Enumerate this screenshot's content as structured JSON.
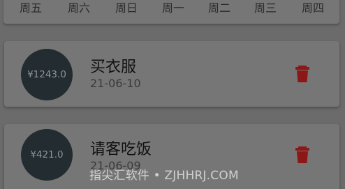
{
  "weekdays": [
    "周五",
    "周六",
    "周日",
    "周一",
    "周二",
    "周三",
    "周四"
  ],
  "records": [
    {
      "amount": "¥1243.0",
      "title": "买衣服",
      "date": "21-06-10"
    },
    {
      "amount": "¥421.0",
      "title": "请客吃饭",
      "date": "21-06-09"
    }
  ],
  "icons": {
    "delete": "trash-icon"
  },
  "colors": {
    "delete": "#8b1717",
    "circle": "#232c31",
    "overlay_bg": "#6b6b6b"
  },
  "watermark": "指尖汇软件 • ZJHHRJ.COM"
}
